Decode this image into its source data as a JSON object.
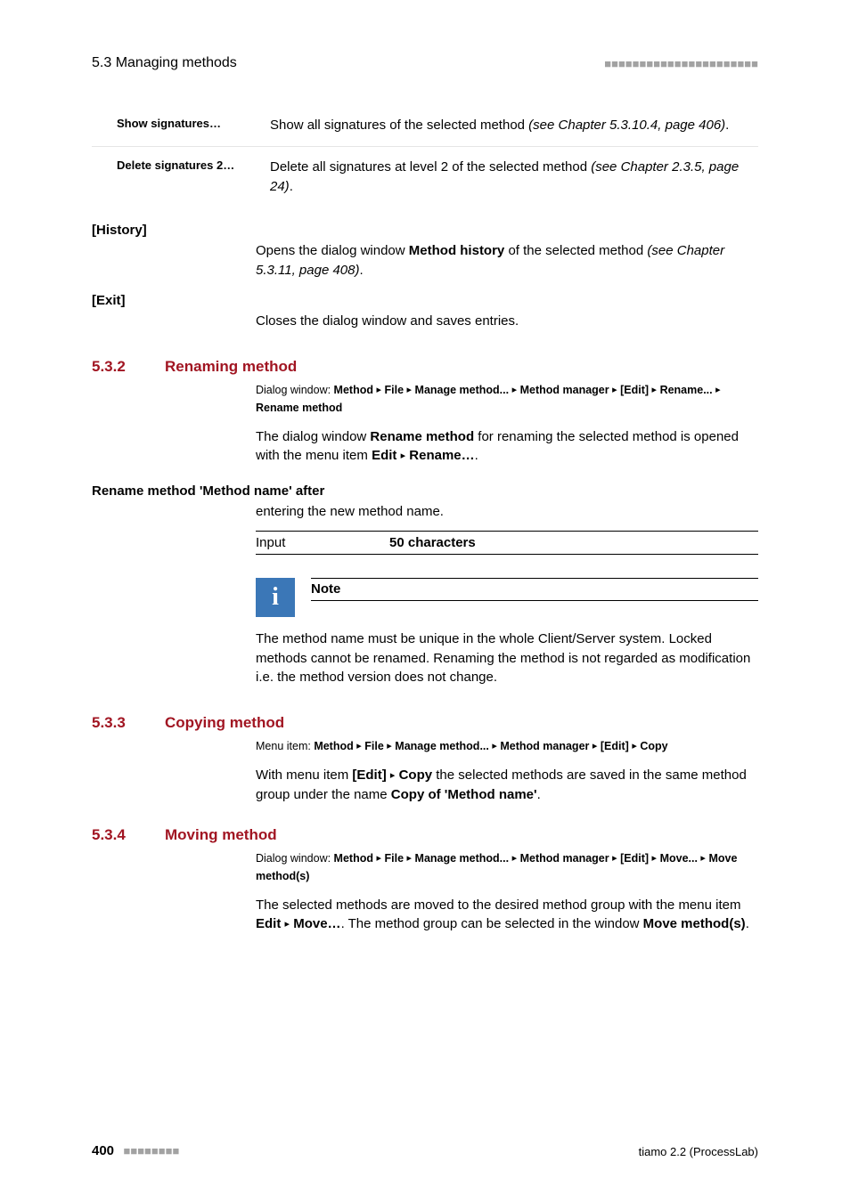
{
  "header": {
    "section": "5.3 Managing methods",
    "bars": "■■■■■■■■■■■■■■■■■■■■■■"
  },
  "defs": {
    "r1_term": "Show signatures…",
    "r1_desc_a": "Show all signatures of the selected method ",
    "r1_desc_b": "(see Chapter 5.3.10.4, page 406)",
    "r1_desc_c": ".",
    "r2_term": "Delete signatures 2…",
    "r2_desc_a": "Delete all signatures at level 2 of the selected method ",
    "r2_desc_b": "(see Chapter 2.3.5, page 24)",
    "r2_desc_c": "."
  },
  "history": {
    "label": "[History]",
    "text_a": "Opens the dialog window ",
    "text_b": "Method history",
    "text_c": " of the selected method ",
    "text_d": "(see Chapter 5.3.11, page 408)",
    "text_e": "."
  },
  "exit": {
    "label": "[Exit]",
    "text": "Closes the dialog window and saves entries."
  },
  "s532": {
    "num": "5.3.2",
    "title": "Renaming method",
    "path": {
      "lbl": "Dialog window: ",
      "p1": "Method",
      "p2": "File",
      "p3": "Manage method...",
      "p4": "Method manager",
      "p5": "[Edit]",
      "p6": "Rename...",
      "p7": "Rename method"
    },
    "body_a": "The dialog window ",
    "body_b": "Rename method",
    "body_c": " for renaming the selected method is opened with the menu item ",
    "body_d": "Edit",
    "body_e": "Rename…",
    "body_f": ".",
    "subhead": "Rename method 'Method name' after",
    "subtext": "entering the new method name.",
    "input_lbl": "Input",
    "input_val": "50 characters",
    "note_title": "Note",
    "note_body": "The method name must be unique in the whole Client/Server system. Locked methods cannot be renamed. Renaming the method is not regarded as modification i.e. the method version does not change."
  },
  "s533": {
    "num": "5.3.3",
    "title": "Copying method",
    "path": {
      "lbl": "Menu item: ",
      "p1": "Method",
      "p2": "File",
      "p3": "Manage method...",
      "p4": "Method manager",
      "p5": "[Edit]",
      "p6": "Copy"
    },
    "body_a": "With menu item ",
    "body_b": "[Edit]",
    "body_c": "Copy",
    "body_d": " the selected methods are saved in the same method group under the name ",
    "body_e": "Copy of 'Method name'",
    "body_f": "."
  },
  "s534": {
    "num": "5.3.4",
    "title": "Moving method",
    "path": {
      "lbl": "Dialog window: ",
      "p1": "Method",
      "p2": "File",
      "p3": "Manage method...",
      "p4": "Method manager",
      "p5": "[Edit]",
      "p6": "Move...",
      "p7": "Move method(s)"
    },
    "body_a": "The selected methods are moved to the desired method group with the menu item ",
    "body_b": "Edit",
    "body_c": "Move…",
    "body_d": ". The method group can be selected in the window ",
    "body_e": "Move method(s)",
    "body_f": "."
  },
  "footer": {
    "page": "400",
    "bars": "■■■■■■■■",
    "right": "tiamo 2.2 (ProcessLab)"
  },
  "arrow": "▸"
}
